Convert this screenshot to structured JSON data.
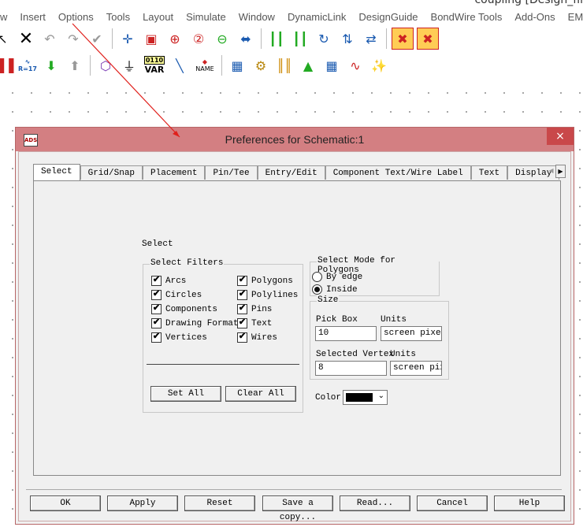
{
  "app": {
    "title_fragment": "coupling [Design_fil",
    "menu": [
      "w",
      "Insert",
      "Options",
      "Tools",
      "Layout",
      "Simulate",
      "Window",
      "DynamicLink",
      "DesignGuide",
      "BondWire Tools",
      "Add-Ons",
      "EM"
    ],
    "toolbar2_labels": {
      "var": "VAR",
      "var_top": "0110",
      "name": "NAME",
      "r17": "R=17"
    }
  },
  "dialog": {
    "title": "Preferences for Schematic:1",
    "close": "×",
    "tabs": [
      "Select",
      "Grid/Snap",
      "Placement",
      "Pin/Tee",
      "Entry/Edit",
      "Component Text/Wire Label",
      "Text",
      "Display"
    ],
    "active_tab": "Select",
    "tab_scroll_left": "◀",
    "tab_scroll_right": "▶",
    "panel": {
      "heading": "Select",
      "filters": {
        "title": "Select Filters",
        "left": [
          {
            "label": "Arcs",
            "checked": true
          },
          {
            "label": "Circles",
            "checked": true
          },
          {
            "label": "Components",
            "checked": true
          },
          {
            "label": "Drawing Format",
            "checked": true
          },
          {
            "label": "Vertices",
            "checked": true
          }
        ],
        "right": [
          {
            "label": "Polygons",
            "checked": true
          },
          {
            "label": "Polylines",
            "checked": true
          },
          {
            "label": "Pins",
            "checked": true
          },
          {
            "label": "Text",
            "checked": true
          },
          {
            "label": "Wires",
            "checked": true
          }
        ],
        "set_all": "Set All",
        "clear_all": "Clear All"
      },
      "polygon_mode": {
        "title": "Select Mode for Polygons",
        "options": [
          {
            "label": "By edge",
            "selected": false
          },
          {
            "label": "Inside",
            "selected": true
          }
        ]
      },
      "size": {
        "title": "Size",
        "pick_box_label": "Pick Box",
        "units_label": "Units",
        "pick_box_value": "10",
        "pick_box_units": "screen pixels",
        "selected_vertex_label": "Selected Vertex",
        "units_label2": "Units",
        "selected_vertex_value": "8",
        "selected_vertex_units": "screen pixels"
      },
      "color": {
        "label": "Color",
        "value": "#000000",
        "arrow": "⌄"
      }
    },
    "buttons": [
      "OK",
      "Apply",
      "Reset",
      "Save a copy...",
      "Read...",
      "Cancel",
      "Help"
    ]
  },
  "colors": {
    "titlebar": "#d37f82",
    "close": "#c9484a",
    "annotation_line": "#e0201c"
  }
}
